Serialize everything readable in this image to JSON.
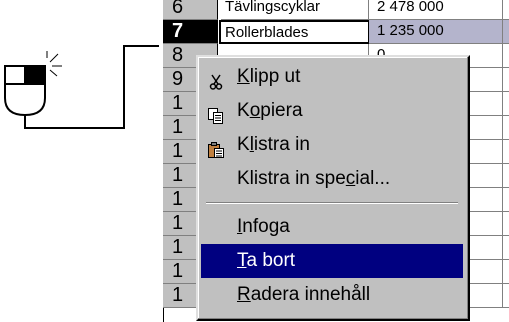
{
  "rows": [
    {
      "num": "6",
      "a": "Tävlingscyklar",
      "b": "2 478 000"
    },
    {
      "num": "7",
      "a": "Rollerblades",
      "b": "1 235 000"
    },
    {
      "num": "8",
      "a": "",
      "b": "0"
    },
    {
      "num": "9",
      "a": "",
      "b": ""
    },
    {
      "num": "1",
      "a": "",
      "b": ""
    },
    {
      "num": "1",
      "a": "",
      "b": ""
    },
    {
      "num": "1",
      "a": "",
      "b": ""
    },
    {
      "num": "1",
      "a": "",
      "b": ""
    },
    {
      "num": "1",
      "a": "",
      "b": ""
    },
    {
      "num": "1",
      "a": "",
      "b": ""
    },
    {
      "num": "1",
      "a": "",
      "b": ""
    },
    {
      "num": "1",
      "a": "",
      "b": ""
    },
    {
      "num": "1",
      "a": "",
      "b": ""
    }
  ],
  "selected_row": "7",
  "context_menu": {
    "items": [
      {
        "pre": "",
        "key": "K",
        "post": "lipp ut",
        "icon": "scissors-icon"
      },
      {
        "pre": "K",
        "key": "o",
        "post": "piera",
        "icon": "copy-icon"
      },
      {
        "pre": "K",
        "key": "l",
        "post": "istra in",
        "icon": "paste-icon"
      },
      {
        "pre": "Klistra in spe",
        "key": "c",
        "post": "ial...",
        "icon": ""
      },
      {
        "pre": "",
        "key": "I",
        "post": "nfoga",
        "icon": ""
      },
      {
        "pre": "",
        "key": "T",
        "post": "a bort",
        "icon": ""
      },
      {
        "pre": "",
        "key": "R",
        "post": "adera innehåll",
        "icon": ""
      }
    ],
    "highlighted_index": 5
  },
  "colors": {
    "menu_bg": "#c0c0c0",
    "highlight": "#000080",
    "selection": "#b4b4cc",
    "header_bg": "#c0c0c0"
  }
}
